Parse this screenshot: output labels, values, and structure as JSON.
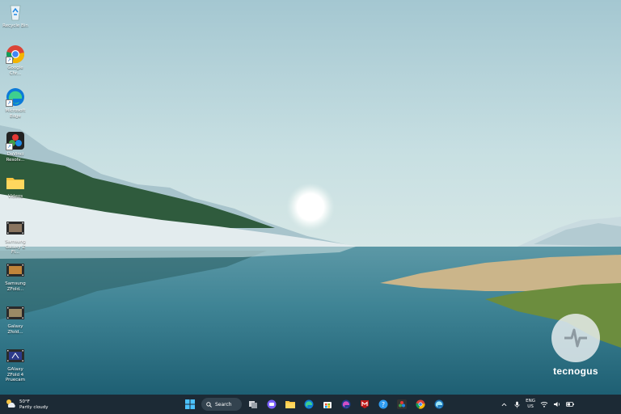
{
  "desktop": {
    "icons": [
      {
        "id": "recycle-bin",
        "label": "Recycle Bin",
        "icon": "recycle-bin-icon"
      },
      {
        "id": "google-chrome",
        "label": "Google Chr...",
        "icon": "chrome-icon"
      },
      {
        "id": "microsoft-edge",
        "label": "Microsoft Edge",
        "icon": "edge-icon"
      },
      {
        "id": "davinci-resolve",
        "label": "DaVinci Resolv...",
        "icon": "davinci-resolve-icon"
      },
      {
        "id": "videos-folder",
        "label": "Videos",
        "icon": "folder-icon"
      },
      {
        "id": "video-1",
        "label": "Samsung Galaxy Z Fl...",
        "icon": "video-file-icon"
      },
      {
        "id": "video-2",
        "label": "Samsung ZFold...",
        "icon": "video-file-icon"
      },
      {
        "id": "video-3",
        "label": "Galaxy Zfold...",
        "icon": "video-file-icon"
      },
      {
        "id": "video-4",
        "label": "GAlaxy ZFold 4 Pruecam",
        "icon": "video-file-icon"
      }
    ]
  },
  "watermark": {
    "text": "tecnogus",
    "icon": "tecnogus-logo-icon"
  },
  "taskbar": {
    "weather": {
      "temp": "50°F",
      "condition": "Partly cloudy",
      "icon": "partly-cloudy-icon"
    },
    "search_label": "Search",
    "pinned": [
      {
        "id": "start",
        "icon": "windows-start-icon"
      },
      {
        "id": "task-view",
        "icon": "task-view-icon"
      },
      {
        "id": "chat",
        "icon": "chat-icon"
      },
      {
        "id": "file-explorer",
        "icon": "folder-icon"
      },
      {
        "id": "edge",
        "icon": "edge-icon"
      },
      {
        "id": "store",
        "icon": "store-icon"
      },
      {
        "id": "edge-dev",
        "icon": "edge-dev-icon"
      },
      {
        "id": "mcafee",
        "icon": "mcafee-icon"
      },
      {
        "id": "help",
        "icon": "help-icon"
      },
      {
        "id": "davinci",
        "icon": "davinci-resolve-icon"
      },
      {
        "id": "chrome",
        "icon": "chrome-icon"
      },
      {
        "id": "edge-beta",
        "icon": "edge-beta-icon"
      }
    ],
    "tray": {
      "lang_top": "ENG",
      "lang_bottom": "US"
    },
    "colors": {
      "bar": "#1c2a35",
      "accent": "#0078d4"
    }
  }
}
